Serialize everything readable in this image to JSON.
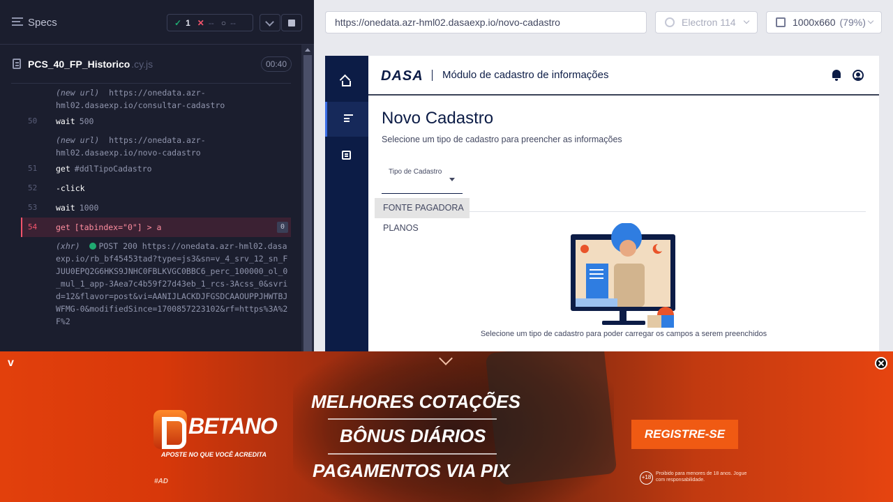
{
  "runner": {
    "specs_label": "Specs",
    "stats": {
      "passed": "1",
      "failed": "--",
      "pending": "--"
    },
    "spec": {
      "name": "PCS_40_FP_Historico",
      "ext": ".cy.js",
      "duration": "00:40"
    },
    "commands": [
      {
        "type": "sub",
        "prefix": "(new url)",
        "text": "https://onedata.azr-hml02.dasaexp.io/consultar-cadastro"
      },
      {
        "type": "cmd",
        "line": "50",
        "name": "wait",
        "message": "500"
      },
      {
        "type": "sub",
        "prefix": "(new url)",
        "text": "https://onedata.azr-hml02.dasaexp.io/novo-cadastro"
      },
      {
        "type": "cmd",
        "line": "51",
        "name": "get",
        "message": "#ddlTipoCadastro"
      },
      {
        "type": "cmd",
        "line": "52",
        "name": "-click",
        "message": ""
      },
      {
        "type": "cmd",
        "line": "53",
        "name": "wait",
        "message": "1000"
      },
      {
        "type": "active",
        "line": "54",
        "name": "get",
        "message": "[tabindex=\"0\"] > a",
        "count": "0"
      }
    ],
    "xhr": {
      "prefix": "(xhr)",
      "text": "POST 200 https://onedata.azr-hml02.dasaexp.io/rb_bf45453tad?type=js3&sn=v_4_srv_12_sn_FJUU0EPQ2G6HKS9JNHC0FBLKVGC0BBC6_perc_100000_ol_0_mul_1_app-3Aea7c4b59f27d43eb_1_rcs-3Acss_0&svrid=12&flavor=post&vi=AANIJLACKDJFGSDCAAOUPPJHWTBJWFMG-0&modifiedSince=1700857223102&rf=https%3A%2F%2"
    }
  },
  "aut": {
    "url": "https://onedata.azr-hml02.dasaexp.io/novo-cadastro",
    "browser": "Electron 114",
    "viewport": "1000x660",
    "scale": "(79%)"
  },
  "app": {
    "logo": "DASA",
    "module_title": "Módulo de cadastro de informações",
    "page_title": "Novo Cadastro",
    "subtitle": "Selecione um tipo de cadastro para preencher as informações",
    "select_label": "Tipo de Cadastro",
    "options": [
      "FONTE PAGADORA",
      "PLANOS"
    ],
    "caption": "Selecione um tipo de cadastro para poder carregar os campos a serem preenchidos"
  },
  "ad": {
    "brand": "BETANO",
    "tagline": "APOSTE NO QUE VOCÊ ACREDITA",
    "hashtag": "#AD",
    "lines": [
      "MELHORES COTAÇÕES",
      "BÔNUS DIÁRIOS",
      "PAGAMENTOS VIA PIX"
    ],
    "cta": "REGISTRE-SE",
    "age": "+18",
    "legal": "Proibido para menores de 18 anos. Jogue com responsabilidade."
  },
  "colors": {
    "nav": "#0c1c46",
    "ad_orange": "#e2400c",
    "cta": "#f05a13",
    "fail": "#f4546c",
    "pass": "#1fa971"
  }
}
